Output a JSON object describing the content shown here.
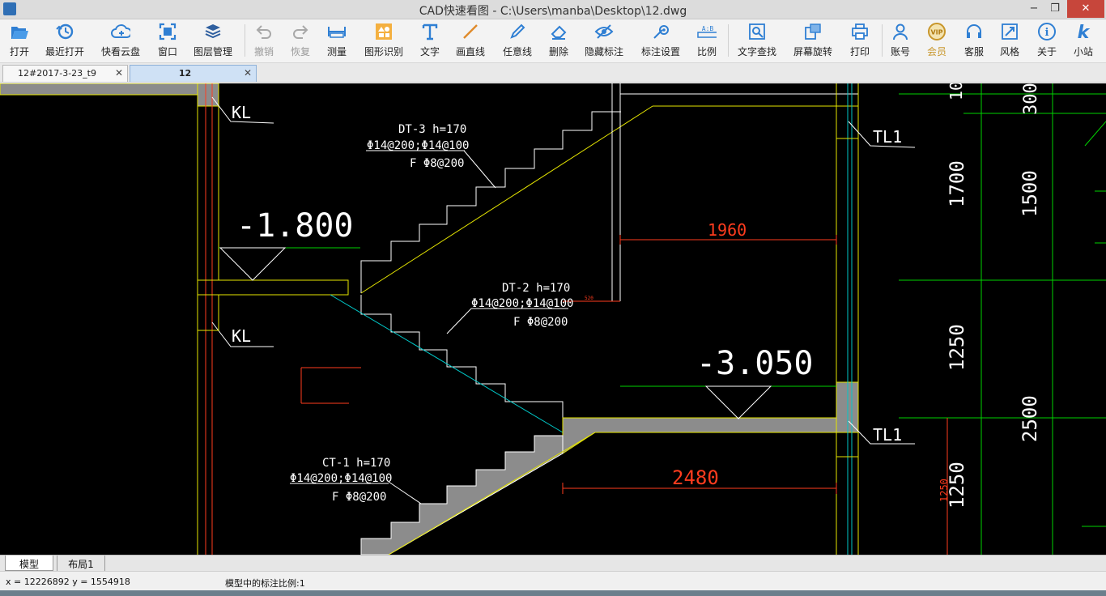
{
  "window": {
    "title": "CAD快速看图 - C:\\Users\\manba\\Desktop\\12.dwg",
    "minimize_icon": "minimize-icon",
    "maximize_icon": "restore-icon",
    "close_icon": "close-icon",
    "minimize_glyph": "−",
    "maximize_glyph": "❐",
    "close_glyph": "✕"
  },
  "toolbar": {
    "buttons": [
      {
        "label": "打开",
        "icon": "folder-open-icon",
        "enabled": true
      },
      {
        "label": "最近打开",
        "icon": "history-icon",
        "enabled": true
      },
      {
        "label": "快看云盘",
        "icon": "cloud-icon",
        "enabled": true
      },
      {
        "label": "窗口",
        "icon": "window-icon",
        "enabled": true
      },
      {
        "label": "图层管理",
        "icon": "layers-icon",
        "enabled": true
      },
      {
        "label": "撤销",
        "icon": "undo-icon",
        "enabled": false
      },
      {
        "label": "恢复",
        "icon": "redo-icon",
        "enabled": false
      },
      {
        "label": "测量",
        "icon": "ruler-icon",
        "enabled": true
      },
      {
        "label": "图形识别",
        "icon": "shape-recognize-icon",
        "enabled": true
      },
      {
        "label": "文字",
        "icon": "text-icon",
        "enabled": true
      },
      {
        "label": "画直线",
        "icon": "line-icon",
        "enabled": true
      },
      {
        "label": "任意线",
        "icon": "pen-icon",
        "enabled": true
      },
      {
        "label": "删除",
        "icon": "eraser-icon",
        "enabled": true
      },
      {
        "label": "隐藏标注",
        "icon": "eye-hide-icon",
        "enabled": true
      },
      {
        "label": "标注设置",
        "icon": "annotation-settings-icon",
        "enabled": true
      },
      {
        "label": "比例",
        "icon": "scale-icon",
        "enabled": true
      },
      {
        "label": "文字查找",
        "icon": "text-search-icon",
        "enabled": true
      },
      {
        "label": "屏幕旋转",
        "icon": "rotate-screen-icon",
        "enabled": true
      },
      {
        "label": "打印",
        "icon": "printer-icon",
        "enabled": true
      },
      {
        "label": "账号",
        "icon": "user-icon",
        "enabled": true
      },
      {
        "label": "会员",
        "icon": "vip-icon",
        "enabled": true
      },
      {
        "label": "客服",
        "icon": "headset-icon",
        "enabled": true
      },
      {
        "label": "风格",
        "icon": "style-icon",
        "enabled": true
      },
      {
        "label": "关于",
        "icon": "info-icon",
        "enabled": true
      },
      {
        "label": "小站",
        "icon": "site-logo-icon",
        "enabled": true
      }
    ],
    "icon_texts": {
      "scale": "A:B",
      "vip": "VIP",
      "info": "i",
      "site": "k"
    }
  },
  "doc_tabs": [
    {
      "label": "12#2017-3-23_t9",
      "active": false,
      "close": "✕"
    },
    {
      "label": "12",
      "active": true,
      "close": "✕"
    }
  ],
  "drawing": {
    "labels": {
      "kl_top": "KL",
      "kl_mid": "KL",
      "tl1_top": "TL1",
      "tl1_bottom": "TL1",
      "level_upper": "-1.800",
      "level_lower": "-3.050",
      "dt3_title": "DT-3  h=170",
      "dt3_rebar": "Φ14@200;Φ14@100",
      "dt3_dist": "F  Φ8@200",
      "dt2_title": "DT-2  h=170",
      "dt2_rebar": "Φ14@200;Φ14@100",
      "dt2_dist": "F  Φ8@200",
      "ct1_title": "CT-1  h=170",
      "ct1_rebar": "Φ14@200;Φ14@100",
      "ct1_dist": "F  Φ8@200",
      "dim_1960": "1960",
      "dim_2480": "2480",
      "dim_small_520": "520",
      "dim_10": "10",
      "dim_300": "300",
      "dim_1700": "1700",
      "dim_1500": "1500",
      "dim_1250_a": "1250",
      "dim_2500": "2500",
      "dim_1250_b": "1250",
      "dim_1250_red": "1250"
    },
    "colors": {
      "background": "#000000",
      "yellow": "#e6e600",
      "white": "#ffffff",
      "red": "#ff3c1e",
      "green": "#00d200",
      "cyan": "#00c8c8",
      "gray_fill": "#8c8c8c"
    }
  },
  "layout_tabs": [
    {
      "label": "模型",
      "active": true
    },
    {
      "label": "布局1",
      "active": false
    }
  ],
  "status": {
    "coords": "x = 12226892  y = 1554918",
    "scale_text": "模型中的标注比例:1"
  }
}
